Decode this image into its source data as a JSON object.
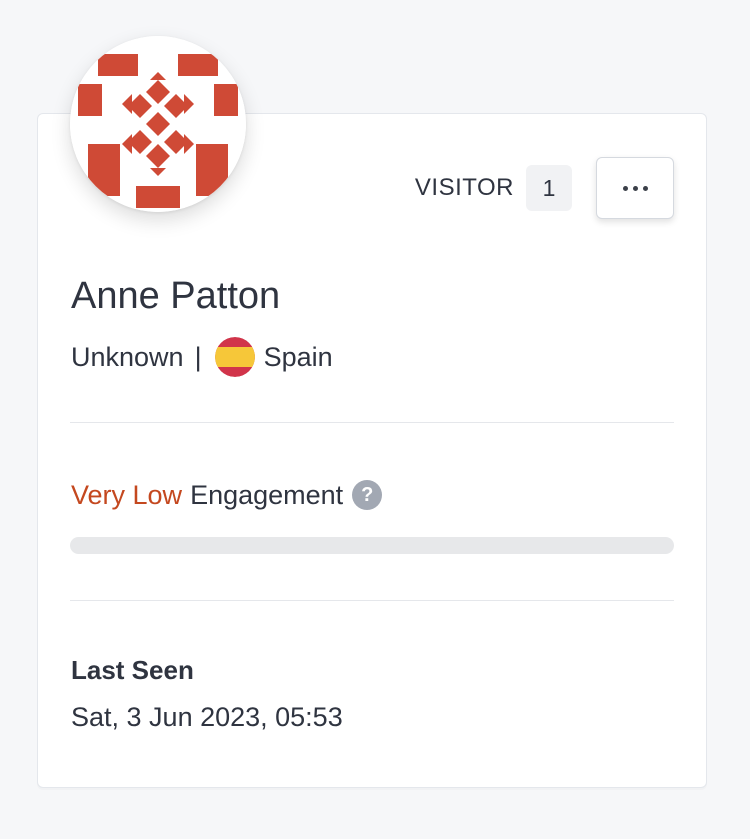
{
  "profile": {
    "name": "Anne Patton",
    "status": "Unknown",
    "separator": "|",
    "country": "Spain",
    "avatar_icon": "identicon-avatar-icon",
    "flag_icon": "spain-flag-icon"
  },
  "badge": {
    "label": "VISITOR",
    "count": "1"
  },
  "actions": {
    "more_icon": "more-horizontal-icon"
  },
  "engagement": {
    "level": "Very Low",
    "label": "Engagement",
    "help_icon": "question-circle-icon",
    "help_symbol": "?",
    "progress_fraction": 0.0
  },
  "last_seen": {
    "label": "Last Seen",
    "value": "Sat, 3 Jun 2023, 05:53"
  },
  "colors": {
    "accent": "#c4481f",
    "text": "#2f3440",
    "background": "#f6f7f9",
    "card": "#ffffff",
    "avatar": "#cf4a36"
  }
}
